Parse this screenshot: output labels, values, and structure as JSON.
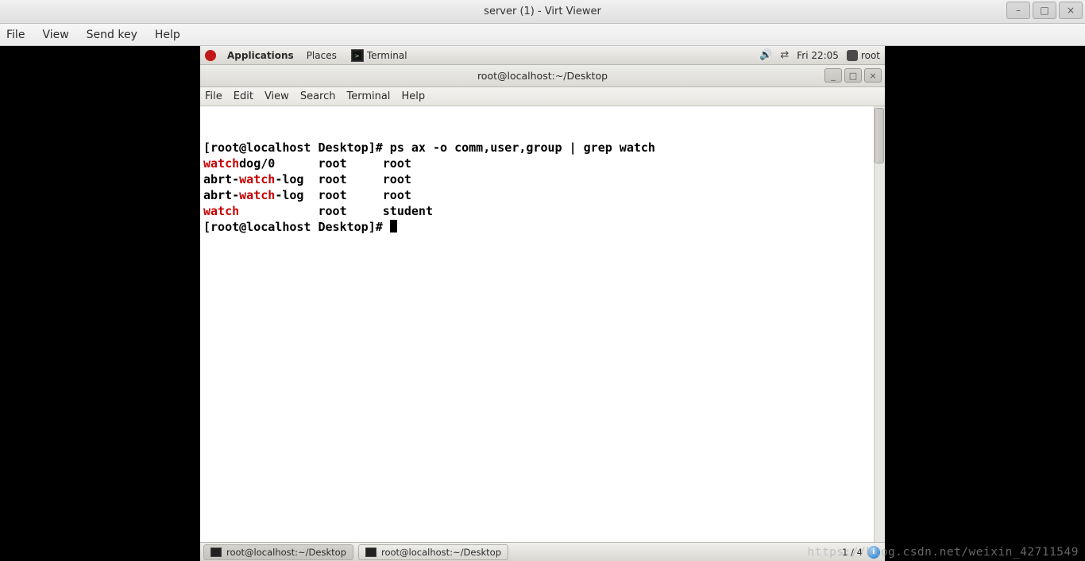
{
  "host": {
    "title": "server (1) - Virt Viewer",
    "controls": {
      "min": "–",
      "max": "□",
      "close": "×"
    },
    "menu": [
      "File",
      "View",
      "Send key",
      "Help"
    ]
  },
  "guest": {
    "top_panel": {
      "applications": "Applications",
      "places": "Places",
      "active_app": "Terminal",
      "clock": "Fri 22:05",
      "user": "root"
    },
    "term": {
      "title": "root@localhost:~/Desktop",
      "menu": [
        "File",
        "Edit",
        "View",
        "Search",
        "Terminal",
        "Help"
      ],
      "prompt": "[root@localhost Desktop]# ",
      "command": "ps ax -o comm,user,group | grep watch",
      "output": [
        {
          "pre": "",
          "m": "watch",
          "post": "dog/0      root     root"
        },
        {
          "pre": "abrt-",
          "m": "watch",
          "post": "-log  root     root"
        },
        {
          "pre": "abrt-",
          "m": "watch",
          "post": "-log  root     root"
        },
        {
          "pre": "",
          "m": "watch",
          "post": "           root     student"
        }
      ]
    },
    "bottom_panel": {
      "tasks": [
        "root@localhost:~/Desktop",
        "root@localhost:~/Desktop"
      ],
      "workspace": "1 / 4"
    }
  },
  "watermark": "https://blog.csdn.net/weixin_42711549"
}
